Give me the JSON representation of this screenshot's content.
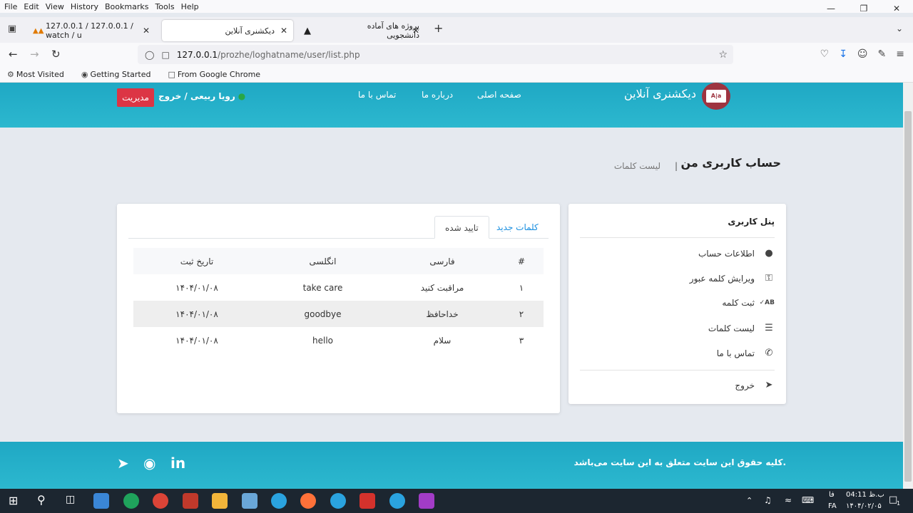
{
  "browser": {
    "menu": [
      "File",
      "Edit",
      "View",
      "History",
      "Bookmarks",
      "Tools",
      "Help"
    ],
    "tabs": [
      {
        "label": "127.0.0.1 / 127.0.0.1 / watch / u"
      },
      {
        "label": "دیکشنری آنلاین"
      },
      {
        "label": "پروژه های آماده دانشجویی"
      }
    ],
    "url_host": "127.0.0.1",
    "url_path": "/prozhe/loghatname/user/list.php",
    "bookmarks": [
      "Most Visited",
      "Getting Started",
      "From Google Chrome"
    ]
  },
  "site": {
    "title": "دیکشنری آنلاین",
    "logo_text": "A|a",
    "nav": [
      "صفحه اصلی",
      "درباره ما",
      "تماس با ما"
    ],
    "user": "رویا ربیعی / خروج",
    "admin_label": "مدیریت"
  },
  "page": {
    "account_title": "حساب کاربری من",
    "separator": "|",
    "breadcrumb": "لیست کلمات"
  },
  "panel": {
    "title": "پنل کاربری",
    "items": [
      {
        "label": "اطلاعات حساب",
        "icon": "user-icon"
      },
      {
        "label": "ویرایش کلمه عبور",
        "icon": "key-icon"
      },
      {
        "label": "ثبت کلمه",
        "icon": "spellcheck-icon"
      },
      {
        "label": "لیست کلمات",
        "icon": "list-icon"
      },
      {
        "label": "تماس با ما",
        "icon": "phone-icon"
      }
    ],
    "logout": "خروج"
  },
  "words": {
    "tabs": [
      "کلمات جدید",
      "تایید شده"
    ],
    "columns": [
      "#",
      "فارسی",
      "انگلسی",
      "تاریخ ثبت"
    ],
    "rows": [
      [
        "۱",
        "مراقبت کنید",
        "take care",
        "۱۴۰۴/۰۱/۰۸"
      ],
      [
        "۲",
        "خداحافظ",
        "goodbye",
        "۱۴۰۴/۰۱/۰۸"
      ],
      [
        "۳",
        "سلام",
        "hello",
        "۱۴۰۴/۰۱/۰۸"
      ]
    ]
  },
  "footer": {
    "copyright": "کلیه حقوق این سایت متعلق به این سایت می‌باشد.",
    "social": [
      "telegram-icon",
      "instagram-icon",
      "linkedin-icon"
    ],
    "linkedin_text": "in"
  },
  "taskbar": {
    "time": "04:11 ب.ظ",
    "date": "۱۴۰۴/۰۲/۰۵",
    "lang_top": "فا",
    "lang_bottom": "FA",
    "notif_count": "1"
  },
  "colors": {
    "header": "#2cb8cf",
    "admin": "#dc3545",
    "link": "#1a8fe0",
    "logo": "#9e3440"
  }
}
